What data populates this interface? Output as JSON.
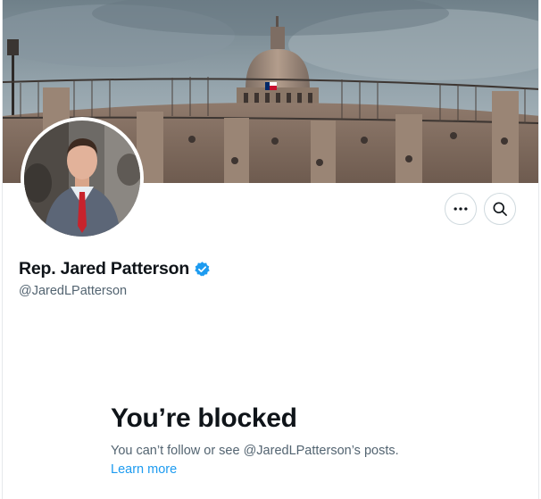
{
  "profile": {
    "display_name": "Rep. Jared Patterson",
    "handle": "@JaredLPatterson",
    "verified": true,
    "verified_color": "#1d9bf0"
  },
  "actions": {
    "more_icon": "more-horizontal-icon",
    "search_icon": "search-icon"
  },
  "blocked": {
    "title": "You’re blocked",
    "description": "You can’t follow or see @JaredLPatterson’s posts.",
    "link": "Learn more"
  },
  "colors": {
    "text_primary": "#0f1419",
    "text_secondary": "#536471",
    "link": "#1d9bf0",
    "border": "#cfd9de"
  }
}
